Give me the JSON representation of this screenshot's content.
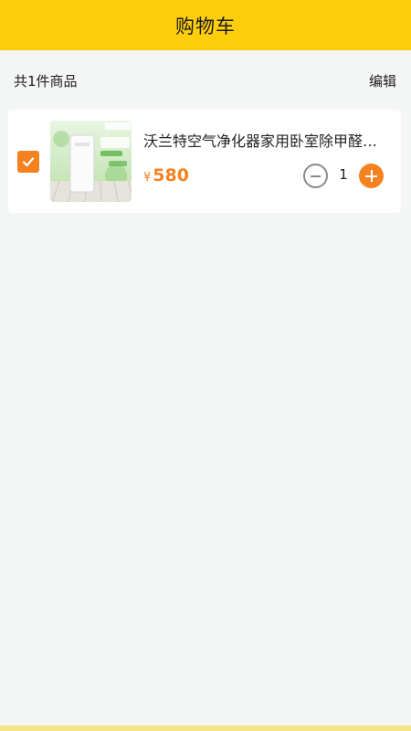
{
  "header": {
    "title": "购物车"
  },
  "summary": {
    "count_text": "共1件商品",
    "edit_label": "编辑"
  },
  "cart": {
    "items": [
      {
        "checked": true,
        "title": "沃兰特空气净化器家用卧室除甲醛…",
        "price_symbol": "¥",
        "price": "580",
        "quantity": "1"
      }
    ]
  },
  "colors": {
    "header_bg": "#fece0c",
    "accent": "#f58220",
    "page_bg": "#f4f5f5"
  },
  "icons": {
    "checkbox": "check-icon",
    "minus": "minus-circle-icon",
    "plus": "plus-circle-icon"
  }
}
